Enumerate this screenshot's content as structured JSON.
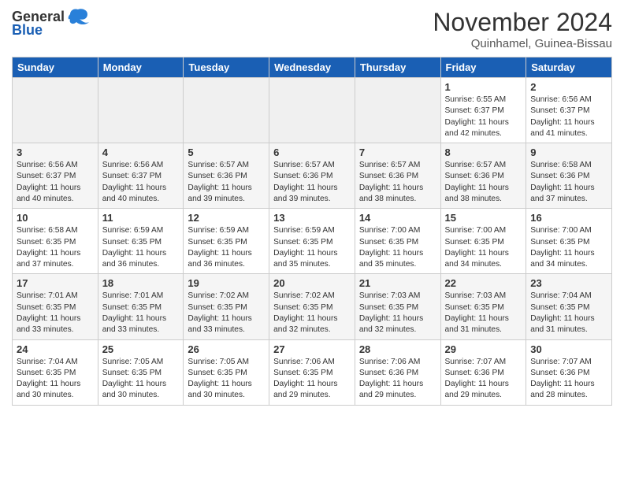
{
  "header": {
    "logo_general": "General",
    "logo_blue": "Blue",
    "title": "November 2024",
    "location": "Quinhamel, Guinea-Bissau"
  },
  "days_of_week": [
    "Sunday",
    "Monday",
    "Tuesday",
    "Wednesday",
    "Thursday",
    "Friday",
    "Saturday"
  ],
  "weeks": [
    [
      {
        "day": "",
        "info": ""
      },
      {
        "day": "",
        "info": ""
      },
      {
        "day": "",
        "info": ""
      },
      {
        "day": "",
        "info": ""
      },
      {
        "day": "",
        "info": ""
      },
      {
        "day": "1",
        "info": "Sunrise: 6:55 AM\nSunset: 6:37 PM\nDaylight: 11 hours and 42 minutes."
      },
      {
        "day": "2",
        "info": "Sunrise: 6:56 AM\nSunset: 6:37 PM\nDaylight: 11 hours and 41 minutes."
      }
    ],
    [
      {
        "day": "3",
        "info": "Sunrise: 6:56 AM\nSunset: 6:37 PM\nDaylight: 11 hours and 40 minutes."
      },
      {
        "day": "4",
        "info": "Sunrise: 6:56 AM\nSunset: 6:37 PM\nDaylight: 11 hours and 40 minutes."
      },
      {
        "day": "5",
        "info": "Sunrise: 6:57 AM\nSunset: 6:36 PM\nDaylight: 11 hours and 39 minutes."
      },
      {
        "day": "6",
        "info": "Sunrise: 6:57 AM\nSunset: 6:36 PM\nDaylight: 11 hours and 39 minutes."
      },
      {
        "day": "7",
        "info": "Sunrise: 6:57 AM\nSunset: 6:36 PM\nDaylight: 11 hours and 38 minutes."
      },
      {
        "day": "8",
        "info": "Sunrise: 6:57 AM\nSunset: 6:36 PM\nDaylight: 11 hours and 38 minutes."
      },
      {
        "day": "9",
        "info": "Sunrise: 6:58 AM\nSunset: 6:36 PM\nDaylight: 11 hours and 37 minutes."
      }
    ],
    [
      {
        "day": "10",
        "info": "Sunrise: 6:58 AM\nSunset: 6:35 PM\nDaylight: 11 hours and 37 minutes."
      },
      {
        "day": "11",
        "info": "Sunrise: 6:59 AM\nSunset: 6:35 PM\nDaylight: 11 hours and 36 minutes."
      },
      {
        "day": "12",
        "info": "Sunrise: 6:59 AM\nSunset: 6:35 PM\nDaylight: 11 hours and 36 minutes."
      },
      {
        "day": "13",
        "info": "Sunrise: 6:59 AM\nSunset: 6:35 PM\nDaylight: 11 hours and 35 minutes."
      },
      {
        "day": "14",
        "info": "Sunrise: 7:00 AM\nSunset: 6:35 PM\nDaylight: 11 hours and 35 minutes."
      },
      {
        "day": "15",
        "info": "Sunrise: 7:00 AM\nSunset: 6:35 PM\nDaylight: 11 hours and 34 minutes."
      },
      {
        "day": "16",
        "info": "Sunrise: 7:00 AM\nSunset: 6:35 PM\nDaylight: 11 hours and 34 minutes."
      }
    ],
    [
      {
        "day": "17",
        "info": "Sunrise: 7:01 AM\nSunset: 6:35 PM\nDaylight: 11 hours and 33 minutes."
      },
      {
        "day": "18",
        "info": "Sunrise: 7:01 AM\nSunset: 6:35 PM\nDaylight: 11 hours and 33 minutes."
      },
      {
        "day": "19",
        "info": "Sunrise: 7:02 AM\nSunset: 6:35 PM\nDaylight: 11 hours and 33 minutes."
      },
      {
        "day": "20",
        "info": "Sunrise: 7:02 AM\nSunset: 6:35 PM\nDaylight: 11 hours and 32 minutes."
      },
      {
        "day": "21",
        "info": "Sunrise: 7:03 AM\nSunset: 6:35 PM\nDaylight: 11 hours and 32 minutes."
      },
      {
        "day": "22",
        "info": "Sunrise: 7:03 AM\nSunset: 6:35 PM\nDaylight: 11 hours and 31 minutes."
      },
      {
        "day": "23",
        "info": "Sunrise: 7:04 AM\nSunset: 6:35 PM\nDaylight: 11 hours and 31 minutes."
      }
    ],
    [
      {
        "day": "24",
        "info": "Sunrise: 7:04 AM\nSunset: 6:35 PM\nDaylight: 11 hours and 30 minutes."
      },
      {
        "day": "25",
        "info": "Sunrise: 7:05 AM\nSunset: 6:35 PM\nDaylight: 11 hours and 30 minutes."
      },
      {
        "day": "26",
        "info": "Sunrise: 7:05 AM\nSunset: 6:35 PM\nDaylight: 11 hours and 30 minutes."
      },
      {
        "day": "27",
        "info": "Sunrise: 7:06 AM\nSunset: 6:35 PM\nDaylight: 11 hours and 29 minutes."
      },
      {
        "day": "28",
        "info": "Sunrise: 7:06 AM\nSunset: 6:36 PM\nDaylight: 11 hours and 29 minutes."
      },
      {
        "day": "29",
        "info": "Sunrise: 7:07 AM\nSunset: 6:36 PM\nDaylight: 11 hours and 29 minutes."
      },
      {
        "day": "30",
        "info": "Sunrise: 7:07 AM\nSunset: 6:36 PM\nDaylight: 11 hours and 28 minutes."
      }
    ]
  ]
}
